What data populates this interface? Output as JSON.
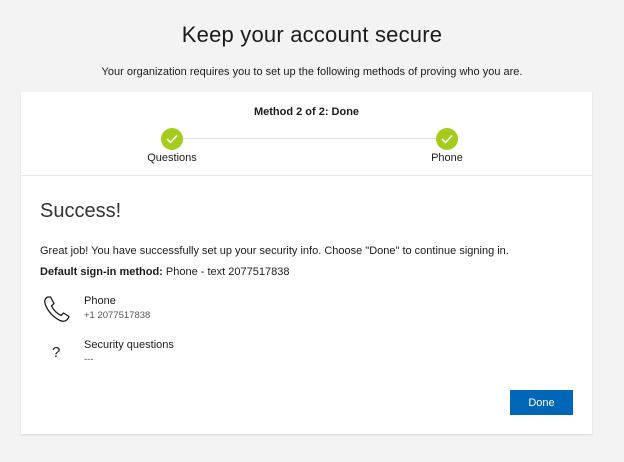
{
  "header": {
    "title": "Keep your account secure",
    "subtitle": "Your organization requires you to set up the following methods of proving who you are."
  },
  "progress": {
    "method_label": "Method 2 of 2: Done",
    "steps": [
      {
        "label": "Questions",
        "status": "complete",
        "icon": "checkmark-icon"
      },
      {
        "label": "Phone",
        "status": "complete",
        "icon": "checkmark-icon"
      }
    ],
    "complete_color": "#a4cc1c"
  },
  "content": {
    "title": "Success!",
    "message": "Great job! You have successfully set up your security info. Choose \"Done\" to continue signing in.",
    "default_method_label": "Default sign-in method:",
    "default_method_value": " Phone - text 2077517838",
    "methods": [
      {
        "name": "Phone",
        "detail": "+1 2077517838",
        "icon": "phone-icon"
      },
      {
        "name": "Security questions",
        "detail": "---",
        "icon": "question-mark-icon",
        "glyph": "?"
      }
    ]
  },
  "actions": {
    "done_label": "Done",
    "primary_color": "#0067b8"
  }
}
